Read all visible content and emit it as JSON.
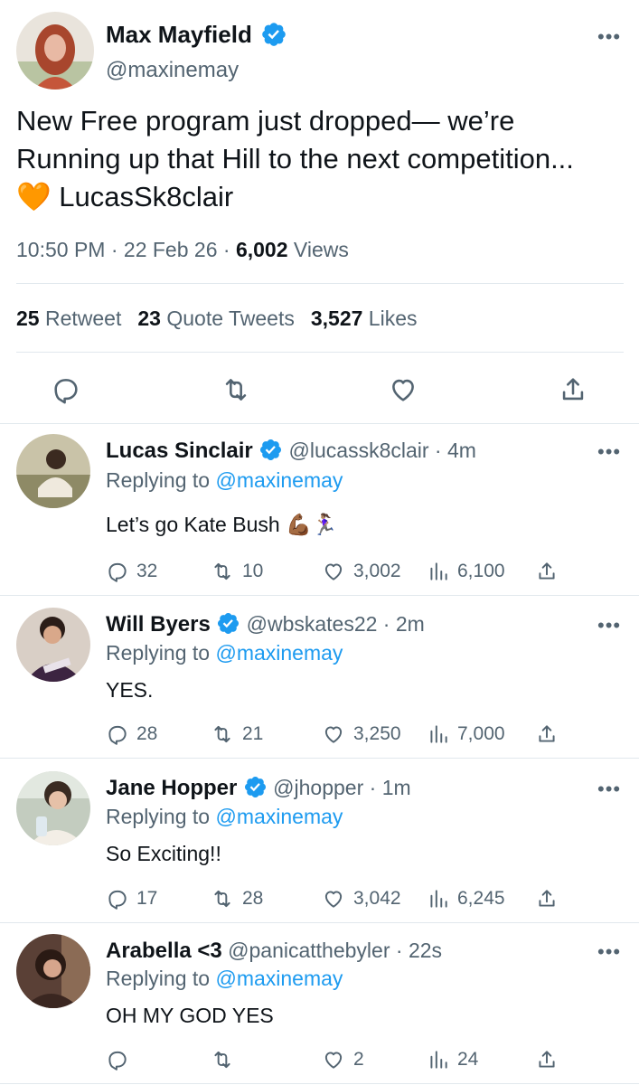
{
  "main_tweet": {
    "name": "Max Mayfield",
    "handle": "@maxinemay",
    "text_part1": "New Free program just dropped— we’re Running up that Hill to the next competition... ",
    "emoji": "🧡",
    "text_part2": " LucasSk8clair",
    "time": "10:50 PM",
    "date": "22 Feb 26",
    "views_count": "6,002",
    "views_label": "Views",
    "retweets_count": "25",
    "retweets_label": "Retweet",
    "quotes_count": "23",
    "quotes_label": "Quote Tweets",
    "likes_count": "3,527",
    "likes_label": "Likes",
    "icons": [
      "reply-icon",
      "retweet-icon",
      "like-icon",
      "share-icon"
    ]
  },
  "replies": [
    {
      "name": "Lucas Sinclair",
      "handle": "@lucassk8clair",
      "time": "4m",
      "replying_label": "Replying to",
      "replying_to": "@maxinemay",
      "text": "Let’s go Kate Bush 💪🏾🏃🏽‍♀️",
      "replies": "32",
      "retweets": "10",
      "likes": "3,002",
      "views": "6,100"
    },
    {
      "name": "Will Byers",
      "handle": "@wbskates22",
      "time": "2m",
      "replying_label": "Replying to",
      "replying_to": "@maxinemay",
      "text": "YES.",
      "replies": "28",
      "retweets": "21",
      "likes": "3,250",
      "views": "7,000"
    },
    {
      "name": "Jane Hopper",
      "handle": "@jhopper",
      "time": "1m",
      "replying_label": "Replying to",
      "replying_to": "@maxinemay",
      "text": "So Exciting!!",
      "replies": "17",
      "retweets": "28",
      "likes": "3,042",
      "views": "6,245"
    },
    {
      "name": "Arabella <3",
      "handle": "@panicatthebyler",
      "time": "22s",
      "replying_label": "Replying to",
      "replying_to": "@maxinemay",
      "text": "OH MY GOD YES",
      "replies": "",
      "retweets": "",
      "likes": "2",
      "views": "24"
    }
  ],
  "colors": {
    "accent": "#1d9bf0",
    "text": "#0f1419",
    "muted": "#536471",
    "divider": "#e1e8ed"
  }
}
